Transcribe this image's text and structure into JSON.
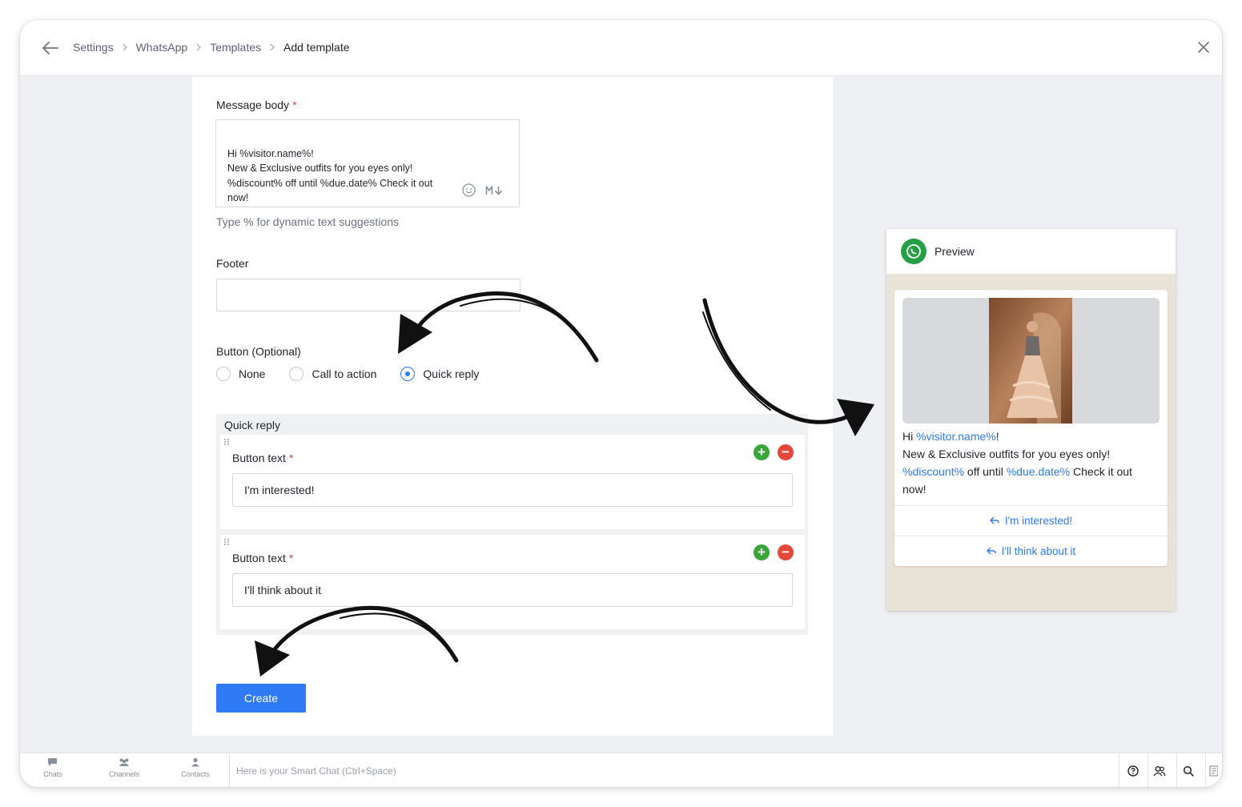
{
  "breadcrumb": {
    "items": [
      "Settings",
      "WhatsApp",
      "Templates"
    ],
    "current": "Add template"
  },
  "form": {
    "message_body_label": "Message body",
    "required_mark": "*",
    "message_body_value": "Hi %visitor.name%!\nNew & Exclusive outfits for you eyes only!\n%discount% off until %due.date% Check it out\nnow!",
    "hint": "Type % for dynamic text suggestions",
    "footer_label": "Footer",
    "footer_value": "",
    "button_label": "Button (Optional)",
    "button_options": [
      "None",
      "Call to action",
      "Quick reply"
    ],
    "button_selected": "Quick reply",
    "quick_reply": {
      "title": "Quick reply",
      "items": [
        {
          "label": "Button text",
          "value": "I'm interested!"
        },
        {
          "label": "Button text",
          "value": "I'll think about it"
        }
      ]
    },
    "create_label": "Create"
  },
  "preview": {
    "title": "Preview",
    "message": {
      "greeting": "Hi ",
      "var_name": "%visitor.name%",
      "excl": "!",
      "line2": "New & Exclusive outfits for you eyes only!",
      "var_discount": "%discount%",
      "mid": " off until ",
      "var_date": "%due.date%",
      "end": " Check it out now!"
    },
    "buttons": [
      "I'm interested!",
      "I'll think about it"
    ]
  },
  "bottom_bar": {
    "nav": [
      "Chats",
      "Channels",
      "Contacts"
    ],
    "smart_chat_placeholder": "Here is your Smart Chat (Ctrl+Space)"
  },
  "colors": {
    "accent": "#2f7bf5",
    "add": "#3aa53a",
    "remove": "#e5483b",
    "whatsapp": "#25a046"
  }
}
